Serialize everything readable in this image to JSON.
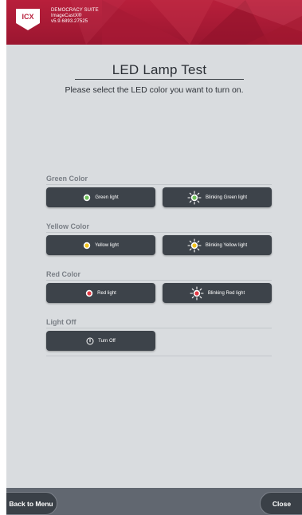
{
  "header": {
    "logo_text": "ICX",
    "product_line1": "DEMOCRACY SUITE",
    "product_line2": "ImageCastX®",
    "version": "v5.9.6893.27525",
    "brand_color": "#b81f3b"
  },
  "page": {
    "title": "LED Lamp Test",
    "subtitle": "Please select the LED color you want to turn on."
  },
  "sections": {
    "green": {
      "label": "Green Color",
      "solid_button": "Green light",
      "blink_button": "Blinking Green light",
      "color": "#6fc25a"
    },
    "yellow": {
      "label": "Yellow Color",
      "solid_button": "Yellow light",
      "blink_button": "Blinking Yellow light",
      "color": "#f2c31c"
    },
    "red": {
      "label": "Red Color",
      "solid_button": "Red light",
      "blink_button": "Blinking Red light",
      "color": "#e23a45"
    },
    "off": {
      "label": "Light Off",
      "off_button": "Turn Off"
    }
  },
  "footer": {
    "back_label": "Back to Menu",
    "close_label": "Close"
  }
}
